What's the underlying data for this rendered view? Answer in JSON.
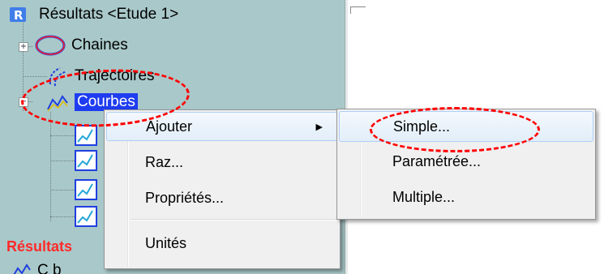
{
  "tree": {
    "root_label": "Résultats <Etude 1>",
    "items": [
      {
        "label": "Chaines",
        "icon": "chain-ellipse-icon",
        "expander": "+"
      },
      {
        "label": "Trajectoires",
        "icon": "trajectory-icon",
        "expander": ""
      },
      {
        "label": "Courbes",
        "icon": "curve-folder-icon",
        "expander": "−"
      }
    ],
    "child_icons": [
      "curve-icon",
      "curve-icon",
      "curve-icon",
      "curve-icon"
    ],
    "section_label": "Résultats",
    "partial_label": "C      b     "
  },
  "context_menu": {
    "items": [
      {
        "label": "Ajouter",
        "has_submenu": true
      },
      {
        "label": "Raz..."
      },
      {
        "label": "Propriétés..."
      },
      {
        "label": "Unités"
      }
    ],
    "submenu_arrow": "▶"
  },
  "submenu": {
    "items": [
      {
        "label": "Simple...",
        "highlighted": true
      },
      {
        "label": "Paramétrée..."
      },
      {
        "label": "Multiple..."
      }
    ]
  },
  "colors": {
    "tree_background": "#a9c8c9",
    "selection": "#1e3cf0",
    "section_header": "#ff2a2a",
    "annotation": "#ff0000"
  }
}
